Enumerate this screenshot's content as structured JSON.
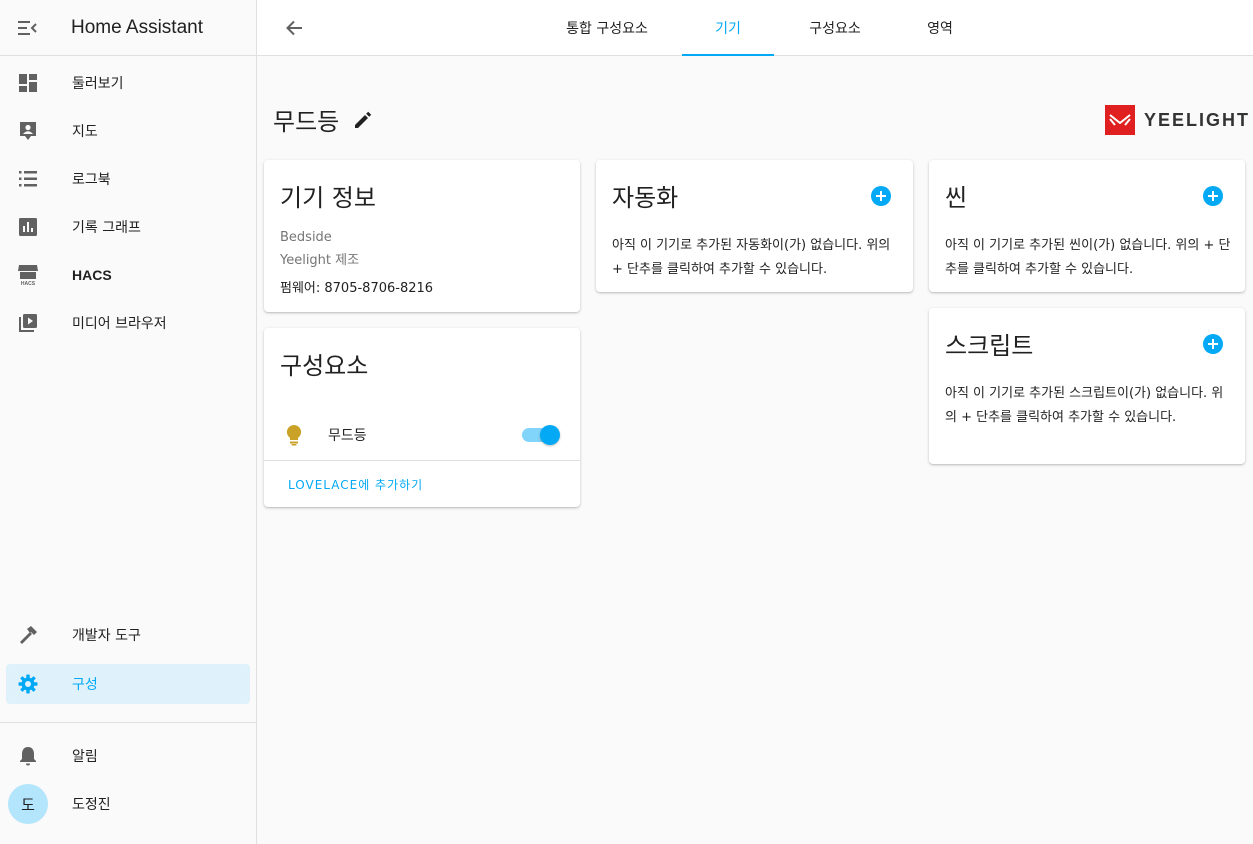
{
  "sidebar": {
    "app_title": "Home Assistant",
    "items": [
      {
        "label": "둘러보기",
        "icon": "dashboard-icon"
      },
      {
        "label": "지도",
        "icon": "map-account-icon"
      },
      {
        "label": "로그북",
        "icon": "list-icon"
      },
      {
        "label": "기록 그래프",
        "icon": "chart-bar-icon"
      },
      {
        "label": "HACS",
        "icon": "hacs-store-icon"
      },
      {
        "label": "미디어 브라우저",
        "icon": "play-box-multiple-icon"
      }
    ],
    "bottom_items": [
      {
        "label": "개발자 도구",
        "icon": "hammer-icon"
      },
      {
        "label": "구성",
        "icon": "gear-icon",
        "active": true
      }
    ],
    "notifications_label": "알림",
    "user": {
      "initial": "도",
      "name": "도정진"
    }
  },
  "topbar": {
    "tabs": [
      {
        "label": "통합 구성요소"
      },
      {
        "label": "기기",
        "active": true
      },
      {
        "label": "구성요소"
      },
      {
        "label": "영역"
      }
    ]
  },
  "page": {
    "title": "무드등",
    "brand": "YEELIGHT"
  },
  "device_info": {
    "title": "기기 정보",
    "model": "Bedside",
    "manufacturer": "Yeelight 제조",
    "firmware": "펌웨어: 8705-8706-8216"
  },
  "entities": {
    "title": "구성요소",
    "rows": [
      {
        "name": "무드등",
        "state": "on"
      }
    ],
    "add_to_lovelace": "LOVELACE에 추가하기"
  },
  "automations": {
    "title": "자동화",
    "empty_text": "아직 이 기기로 추가된 자동화이(가) 없습니다. 위의 + 단추를 클릭하여 추가할 수 있습니다."
  },
  "scenes": {
    "title": "씬",
    "empty_text": "아직 이 기기로 추가된 씬이(가) 없습니다. 위의 + 단추를 클릭하여 추가할 수 있습니다."
  },
  "scripts": {
    "title": "스크립트",
    "empty_text": "아직 이 기기로 추가된 스크립트이(가) 없습니다. 위의 + 단추를 클릭하여 추가할 수 있습니다."
  },
  "colors": {
    "accent": "#03a9f4",
    "active_bg": "#dff2fb",
    "bulb_on": "#c9a227",
    "brand_red": "#e02020"
  }
}
